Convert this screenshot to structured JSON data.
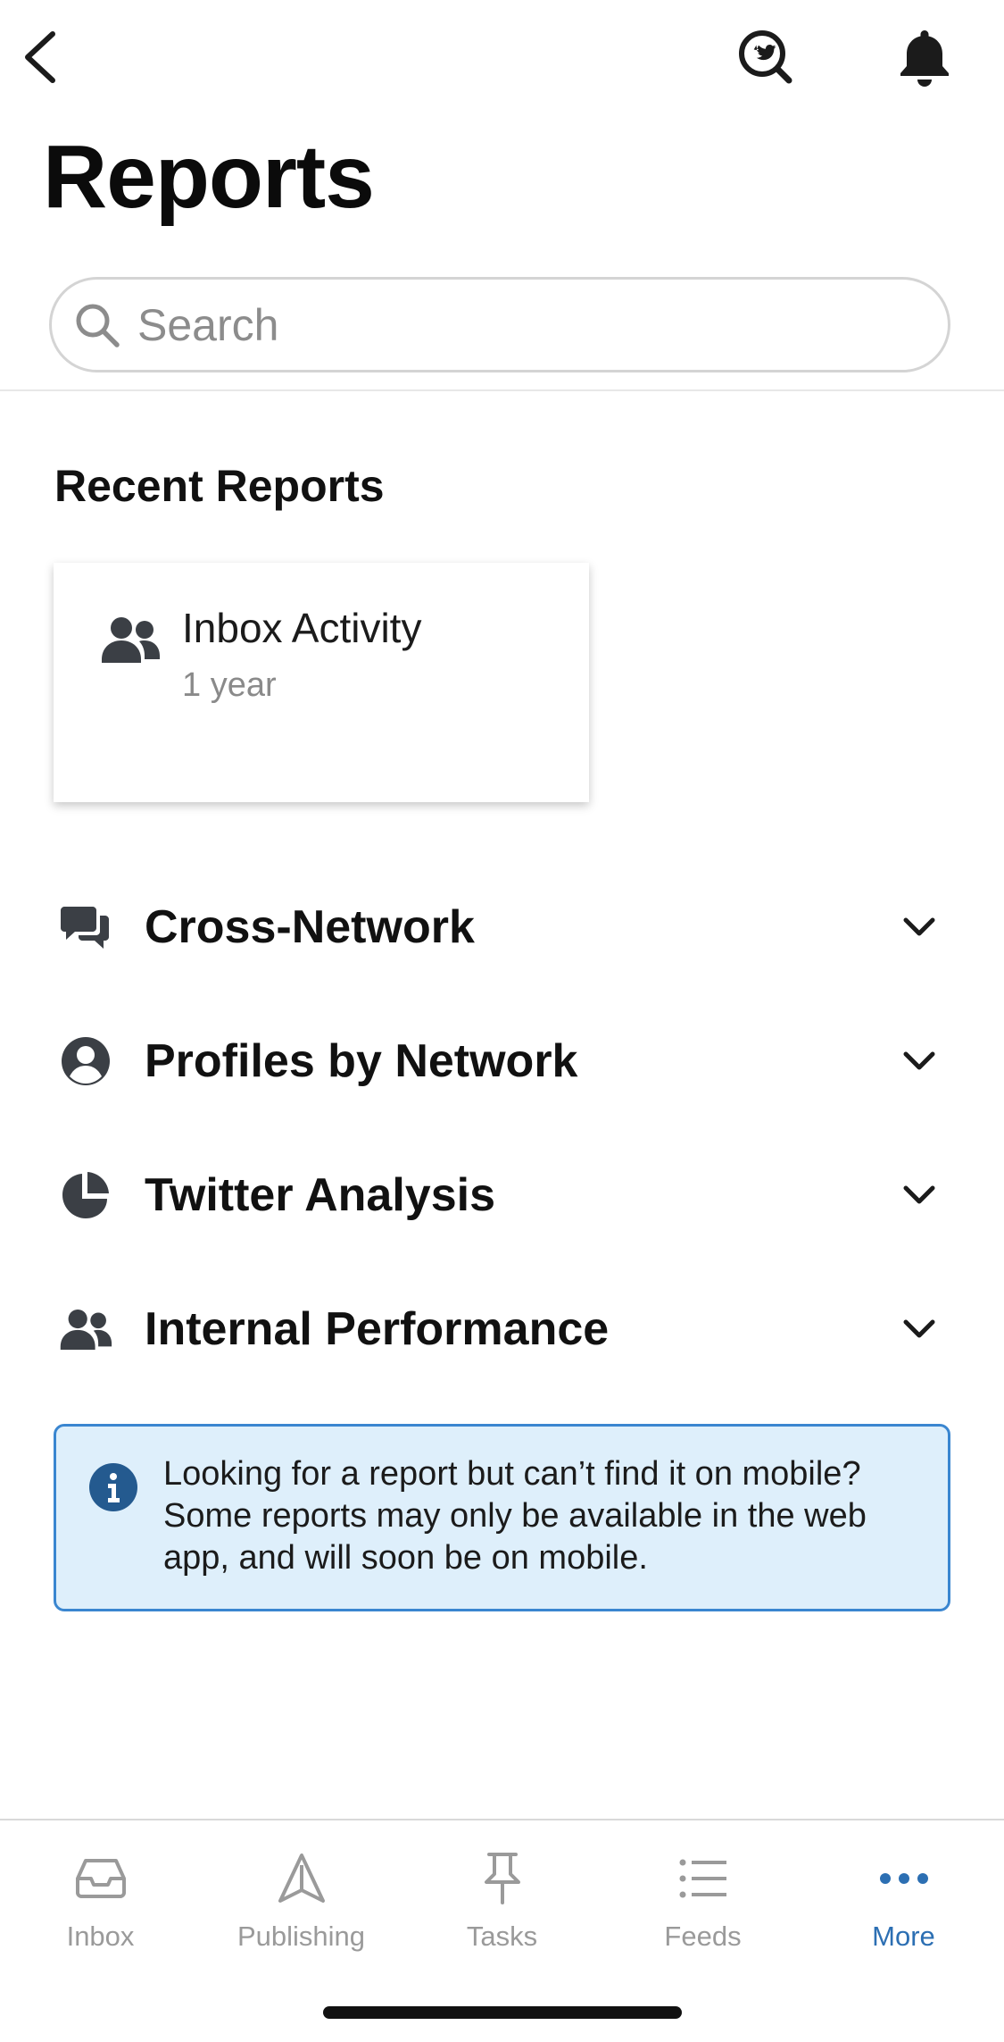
{
  "header": {
    "back_icon": "chevron-left-icon",
    "brand_icon": "twitter-search-icon",
    "notification_icon": "bell-icon"
  },
  "page": {
    "title": "Reports"
  },
  "search": {
    "placeholder": "Search",
    "value": ""
  },
  "recent": {
    "section_title": "Recent Reports",
    "cards": [
      {
        "icon": "users-icon",
        "title": "Inbox Activity",
        "subtitle": "1 year"
      }
    ]
  },
  "categories": [
    {
      "icon": "comments-icon",
      "label": "Cross-Network"
    },
    {
      "icon": "user-circle-icon",
      "label": "Profiles by Network"
    },
    {
      "icon": "pie-chart-icon",
      "label": "Twitter Analysis"
    },
    {
      "icon": "users-icon",
      "label": "Internal Performance"
    }
  ],
  "info": {
    "icon": "info-icon",
    "text": "Looking for a report but can’t find it on mobile?  Some reports may only be available in the web app, and will soon be on mobile."
  },
  "tabbar": {
    "items": [
      {
        "icon": "inbox-tray-icon",
        "label": "Inbox",
        "active": false
      },
      {
        "icon": "paper-plane-icon",
        "label": "Publishing",
        "active": false
      },
      {
        "icon": "pushpin-icon",
        "label": "Tasks",
        "active": false
      },
      {
        "icon": "list-icon",
        "label": "Feeds",
        "active": false
      },
      {
        "icon": "ellipsis-icon",
        "label": "More",
        "active": true
      }
    ]
  },
  "colors": {
    "accent": "#2c6fb3",
    "icon_dark": "#3b3f45",
    "info_bg": "#deeffb",
    "info_border": "#3a86d0"
  }
}
